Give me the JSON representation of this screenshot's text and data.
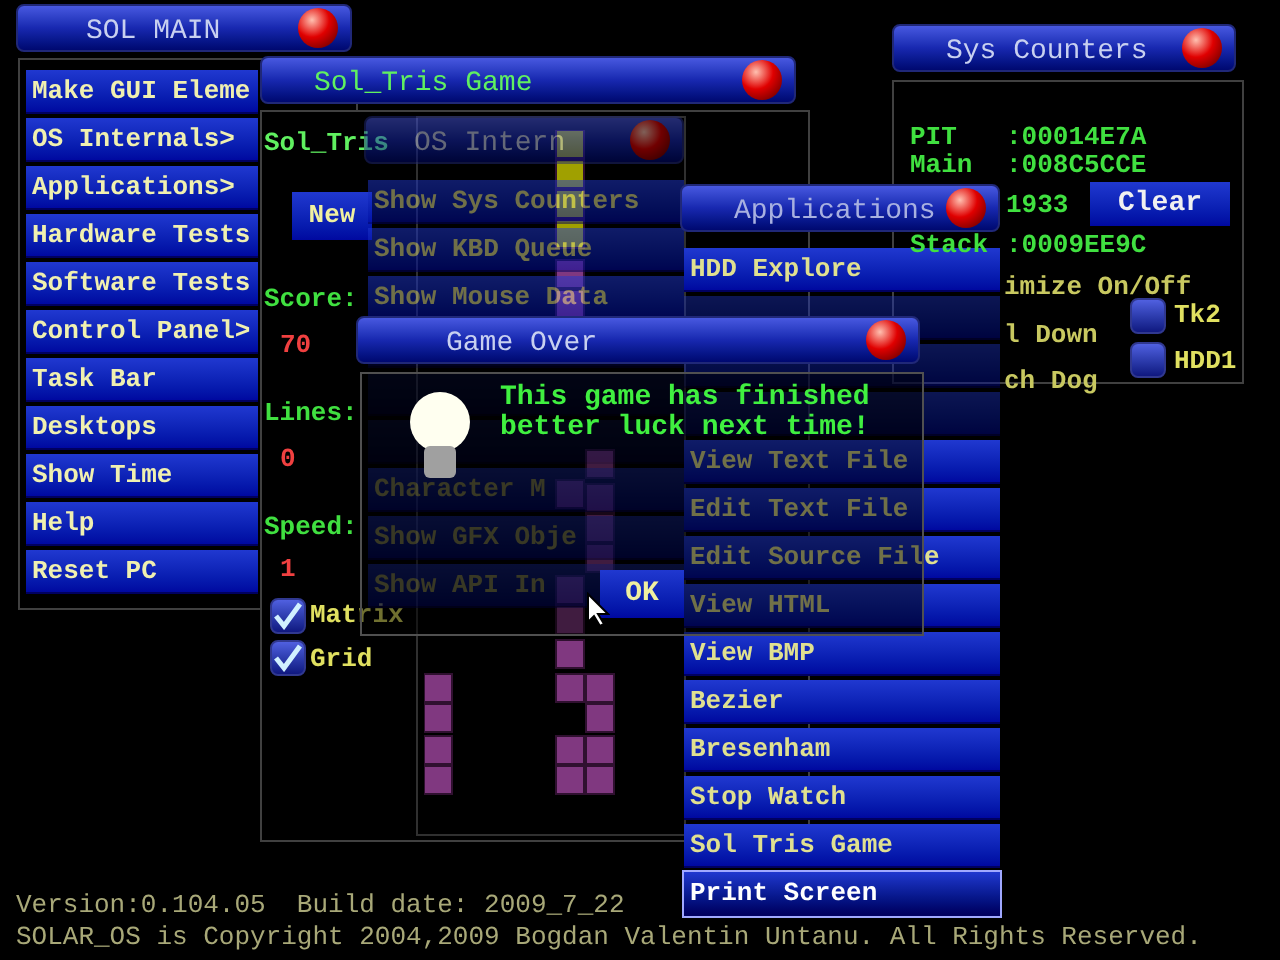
{
  "main_menu": {
    "title": "SOL MAIN",
    "items": [
      "Make GUI Eleme",
      "OS Internals>",
      "Applications>",
      "Hardware Tests",
      "Software Tests",
      "Control Panel>",
      "Task Bar",
      "Desktops",
      "Show Time",
      "Help",
      "Reset PC"
    ]
  },
  "sys_counters": {
    "title": "Sys Counters",
    "rows": [
      {
        "label": "PIT",
        "value": ":00014E7A"
      },
      {
        "label": "Main",
        "value": ":008C5CCE"
      },
      {
        "value": "1933"
      },
      {
        "label": "Stack",
        "value": ":0009EE9C"
      }
    ],
    "clear_button": "Clear",
    "lines": [
      "imize On/Off",
      "l Down",
      "ch Dog"
    ],
    "toggles": [
      {
        "label": "Tk2",
        "checked": false
      },
      {
        "label": "HDD1",
        "checked": false
      }
    ]
  },
  "game_window": {
    "title": "Sol_Tris Game",
    "name": "Sol_Tris",
    "new_button": "New",
    "score_label": "Score:",
    "score": "70",
    "lines_label": "Lines:",
    "lines": "0",
    "speed_label": "Speed:",
    "speed": "1",
    "options": [
      {
        "label": "Matrix",
        "checked": true
      },
      {
        "label": "Grid",
        "checked": true
      }
    ]
  },
  "os_internals": {
    "title": "OS Intern",
    "items": [
      {
        "label": "Show Sys Counters",
        "obscured": false
      },
      {
        "label": "Show KBD Queue",
        "obscured": false
      },
      {
        "label": "Show Mouse Data",
        "obscured": false
      },
      {
        "obscured": true
      },
      {
        "obscured": true
      },
      {
        "obscured": true
      },
      {
        "label": "Character M",
        "obscured": false
      },
      {
        "label": "Show GFX Obje",
        "obscured": false
      },
      {
        "label": "Show API In",
        "obscured": false
      }
    ]
  },
  "applications": {
    "title": "Applications",
    "items": [
      {
        "label": "HDD Explore",
        "obscured": false,
        "selected": false
      },
      {
        "obscured": true,
        "selected": false
      },
      {
        "obscured": true,
        "selected": false
      },
      {
        "obscured": true,
        "selected": false
      },
      {
        "label": "View Text File",
        "obscured": false,
        "selected": false
      },
      {
        "label": "Edit Text File",
        "obscured": false,
        "selected": false
      },
      {
        "label": "Edit Source File",
        "obscured": false,
        "selected": false
      },
      {
        "label": "View HTML",
        "obscured": false,
        "selected": false
      },
      {
        "label": "View BMP",
        "obscured": false,
        "selected": false
      },
      {
        "label": "Bezier",
        "obscured": false,
        "selected": false
      },
      {
        "label": "Bresenham",
        "obscured": false,
        "selected": false
      },
      {
        "label": "Stop Watch",
        "obscured": false,
        "selected": false
      },
      {
        "label": "Sol Tris Game",
        "obscured": false,
        "selected": false
      },
      {
        "label": "Print Screen",
        "obscured": false,
        "selected": true
      }
    ]
  },
  "game_over": {
    "title": "Game Over",
    "message": [
      "This game has finished",
      "better luck next time!"
    ],
    "ok_button": "OK"
  },
  "footer": {
    "version": "Version:0.104.05  Build date: 2009_7_22",
    "copyright": "SOLAR_OS is Copyright 2004,2009 Bogdan Valentin Untanu. All Rights Reserved."
  }
}
